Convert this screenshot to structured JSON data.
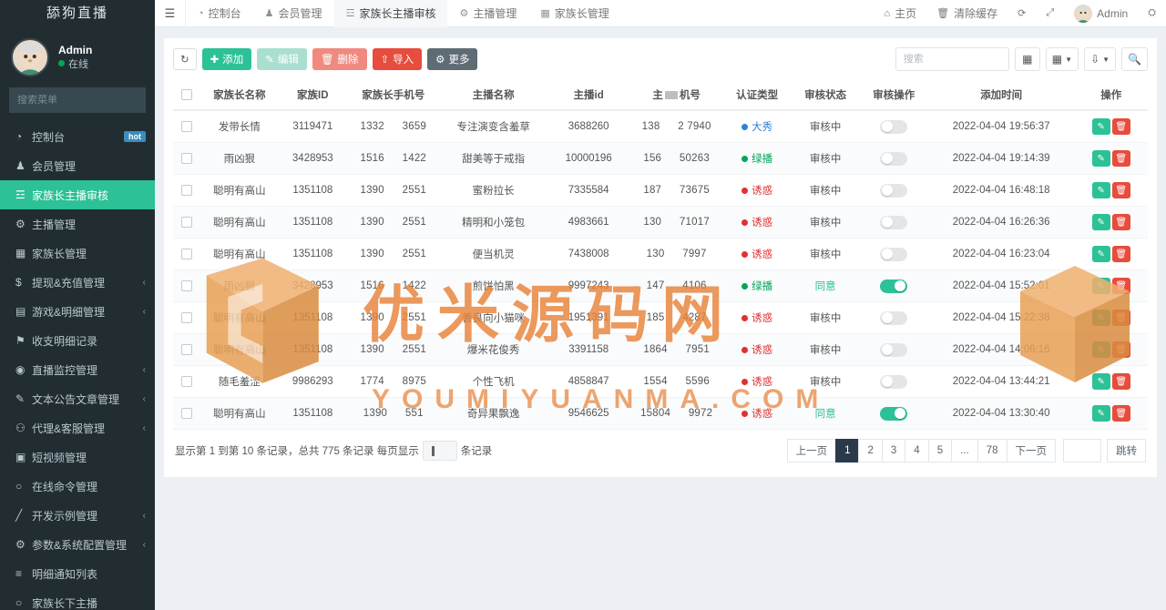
{
  "brand": {
    "title": "舔狗直播"
  },
  "user": {
    "name": "Admin",
    "status": "在线",
    "status_color": "#00a65a"
  },
  "menu_search": {
    "placeholder": "搜索菜单",
    "icon": "search-icon"
  },
  "sidebar": {
    "items": [
      {
        "label": "控制台",
        "icon": "dashboard-icon",
        "badge": "hot",
        "caret": "",
        "active": false
      },
      {
        "label": "会员管理",
        "icon": "user-icon",
        "badge": "",
        "caret": "",
        "active": false
      },
      {
        "label": "家族长主播审核",
        "icon": "bank-icon",
        "badge": "",
        "caret": "",
        "active": true
      },
      {
        "label": "主播管理",
        "icon": "gear-circle-icon",
        "badge": "",
        "caret": "",
        "active": false
      },
      {
        "label": "家族长管理",
        "icon": "grid-icon",
        "badge": "",
        "caret": "",
        "active": false
      },
      {
        "label": "提现&充值管理",
        "icon": "dollar-icon",
        "badge": "",
        "caret": "‹",
        "active": false
      },
      {
        "label": "游戏&明细管理",
        "icon": "calendar-icon",
        "badge": "",
        "caret": "‹",
        "active": false
      },
      {
        "label": "收支明细记录",
        "icon": "flag-icon",
        "badge": "",
        "caret": "",
        "active": false
      },
      {
        "label": "直播监控管理",
        "icon": "record-icon",
        "badge": "",
        "caret": "‹",
        "active": false
      },
      {
        "label": "文本公告文章管理",
        "icon": "note-icon",
        "badge": "",
        "caret": "‹",
        "active": false
      },
      {
        "label": "代理&客服管理",
        "icon": "agent-icon",
        "badge": "",
        "caret": "‹",
        "active": false
      },
      {
        "label": "短视频管理",
        "icon": "video-icon",
        "badge": "",
        "caret": "",
        "active": false
      },
      {
        "label": "在线命令管理",
        "icon": "circle-icon",
        "badge": "",
        "caret": "",
        "active": false
      },
      {
        "label": "开发示例管理",
        "icon": "pencil-icon",
        "badge": "",
        "caret": "‹",
        "active": false
      },
      {
        "label": "参数&系统配置管理",
        "icon": "settings-icon",
        "badge": "",
        "caret": "‹",
        "active": false
      },
      {
        "label": "明细通知列表",
        "icon": "list-icon",
        "badge": "",
        "caret": "",
        "active": false
      },
      {
        "label": "家族长下主播",
        "icon": "circle-icon",
        "badge": "",
        "caret": "",
        "active": false
      }
    ]
  },
  "topnav": {
    "hamburger_icon": "hamburger-icon",
    "tabs": [
      {
        "label": "控制台",
        "icon": "dashboard-icon",
        "active": false
      },
      {
        "label": "会员管理",
        "icon": "user-icon",
        "active": false
      },
      {
        "label": "家族长主播审核",
        "icon": "bank-icon",
        "active": true
      },
      {
        "label": "主播管理",
        "icon": "gear-circle-icon",
        "active": false
      },
      {
        "label": "家族长管理",
        "icon": "grid-icon",
        "active": false
      }
    ],
    "right": [
      {
        "label": "主页",
        "icon": "home-icon"
      },
      {
        "label": "清除缓存",
        "icon": "trash-icon"
      },
      {
        "label": "",
        "icon": "refresh-tab-icon"
      },
      {
        "label": "",
        "icon": "fullscreen-icon"
      },
      {
        "label": "Admin",
        "icon": "avatar-icon"
      },
      {
        "label": "",
        "icon": "gears-icon"
      }
    ]
  },
  "toolbar": {
    "refresh_label": "",
    "add_label": "添加",
    "edit_label": "编辑",
    "delete_label": "删除",
    "import_label": "导入",
    "more_label": "更多",
    "search_placeholder": "搜索",
    "search_value": "",
    "icons": {
      "refresh": "refresh-icon",
      "add": "plus-icon",
      "edit": "pencil-icon",
      "delete": "trash-icon",
      "import": "upload-icon",
      "more": "gear-icon",
      "columns": "columns-icon",
      "grid": "grid-icon",
      "export": "export-icon",
      "search": "search-icon"
    }
  },
  "table": {
    "columns": [
      "",
      "家族长名称",
      "家族ID",
      "家族长手机号",
      "主播名称",
      "主播id",
      "主播手机号",
      "认证类型",
      "审核状态",
      "审核操作",
      "添加时间",
      "操作"
    ],
    "column_redactions": {
      "6": {
        "prefix": "主",
        "suffix": "机号"
      }
    },
    "cert_colors": {
      "大秀": "#2f80d8",
      "绿播": "#00a65a",
      "诱惑": "#e03030"
    },
    "status_colors": {
      "审核中": "#555555",
      "同意": "#2cc196"
    },
    "rows": [
      {
        "family_name": "发带长情",
        "family_id": "3119471",
        "family_phone": "1332   3659",
        "anchor_name": "专注演变含羞草",
        "anchor_id": "3688260",
        "anchor_phone": "138   2 7940",
        "cert": "大秀",
        "status": "审核中",
        "toggle": false,
        "created": "2022-04-04 19:56:37"
      },
      {
        "family_name": "雨凶狠",
        "family_id": "3428953",
        "family_phone": "1516   1422",
        "anchor_name": "甜美等于戒指",
        "anchor_id": "10000196",
        "anchor_phone": "156   50263",
        "cert": "绿播",
        "status": "审核中",
        "toggle": false,
        "created": "2022-04-04 19:14:39"
      },
      {
        "family_name": "聪明有高山",
        "family_id": "1351108",
        "family_phone": "1390   2551",
        "anchor_name": "蜜粉拉长",
        "anchor_id": "7335584",
        "anchor_phone": "187   73675",
        "cert": "诱惑",
        "status": "审核中",
        "toggle": false,
        "created": "2022-04-04 16:48:18"
      },
      {
        "family_name": "聪明有高山",
        "family_id": "1351108",
        "family_phone": "1390   2551",
        "anchor_name": "精明和小笼包",
        "anchor_id": "4983661",
        "anchor_phone": "130   71017",
        "cert": "诱惑",
        "status": "审核中",
        "toggle": false,
        "created": "2022-04-04 16:26:36"
      },
      {
        "family_name": "聪明有高山",
        "family_id": "1351108",
        "family_phone": "1390   2551",
        "anchor_name": "便当机灵",
        "anchor_id": "7438008",
        "anchor_phone": "130   7997",
        "cert": "诱惑",
        "status": "审核中",
        "toggle": false,
        "created": "2022-04-04 16:23:04"
      },
      {
        "family_name": "雨凶狠",
        "family_id": "3428953",
        "family_phone": "1516   1422",
        "anchor_name": "煎饼怕黑",
        "anchor_id": "9997243",
        "anchor_phone": "147   4106",
        "cert": "绿播",
        "status": "同意",
        "toggle": true,
        "created": "2022-04-04 15:52:01"
      },
      {
        "family_name": "聪明有高山",
        "family_id": "1351108",
        "family_phone": "1390   2551",
        "anchor_name": "善良向小猫咪",
        "anchor_id": "1951391",
        "anchor_phone": "185   4287",
        "cert": "诱惑",
        "status": "审核中",
        "toggle": false,
        "created": "2022-04-04 15:22:38"
      },
      {
        "family_name": "聪明有高山",
        "family_id": "1351108",
        "family_phone": "1390   2551",
        "anchor_name": "爆米花俊秀",
        "anchor_id": "3391158",
        "anchor_phone": "1864   7951",
        "cert": "诱惑",
        "status": "审核中",
        "toggle": false,
        "created": "2022-04-04 14:06:16"
      },
      {
        "family_name": "随毛羞涩",
        "family_id": "9986293",
        "family_phone": "1774   8975",
        "anchor_name": "个性飞机",
        "anchor_id": "4858847",
        "anchor_phone": "1554   5596",
        "cert": "诱惑",
        "status": "审核中",
        "toggle": false,
        "created": "2022-04-04 13:44:21"
      },
      {
        "family_name": "聪明有高山",
        "family_id": "1351108",
        "family_phone": "1390   551",
        "anchor_name": "奇异果飘逸",
        "anchor_id": "9546625",
        "anchor_phone": "15804   9972",
        "cert": "诱惑",
        "status": "同意",
        "toggle": true,
        "created": "2022-04-04 13:30:40"
      }
    ],
    "row_actions": {
      "edit_icon": "pencil-icon",
      "delete_icon": "trash-icon"
    }
  },
  "footer": {
    "info_prefix": "显示第 1 到第 10 条记录，总共 775 条记录 每页显示",
    "per_page_value": "1",
    "info_suffix": "条记录",
    "pager": {
      "prev": "上一页",
      "pages": [
        "1",
        "2",
        "3",
        "4",
        "5",
        "...",
        "78"
      ],
      "active_page": "1",
      "next": "下一页",
      "jump_value": "",
      "jump_label": "跳转"
    }
  },
  "watermark": {
    "main": "优米源码网",
    "sub": "YOUMIYUANMA.COM",
    "color": "#e8833a"
  }
}
